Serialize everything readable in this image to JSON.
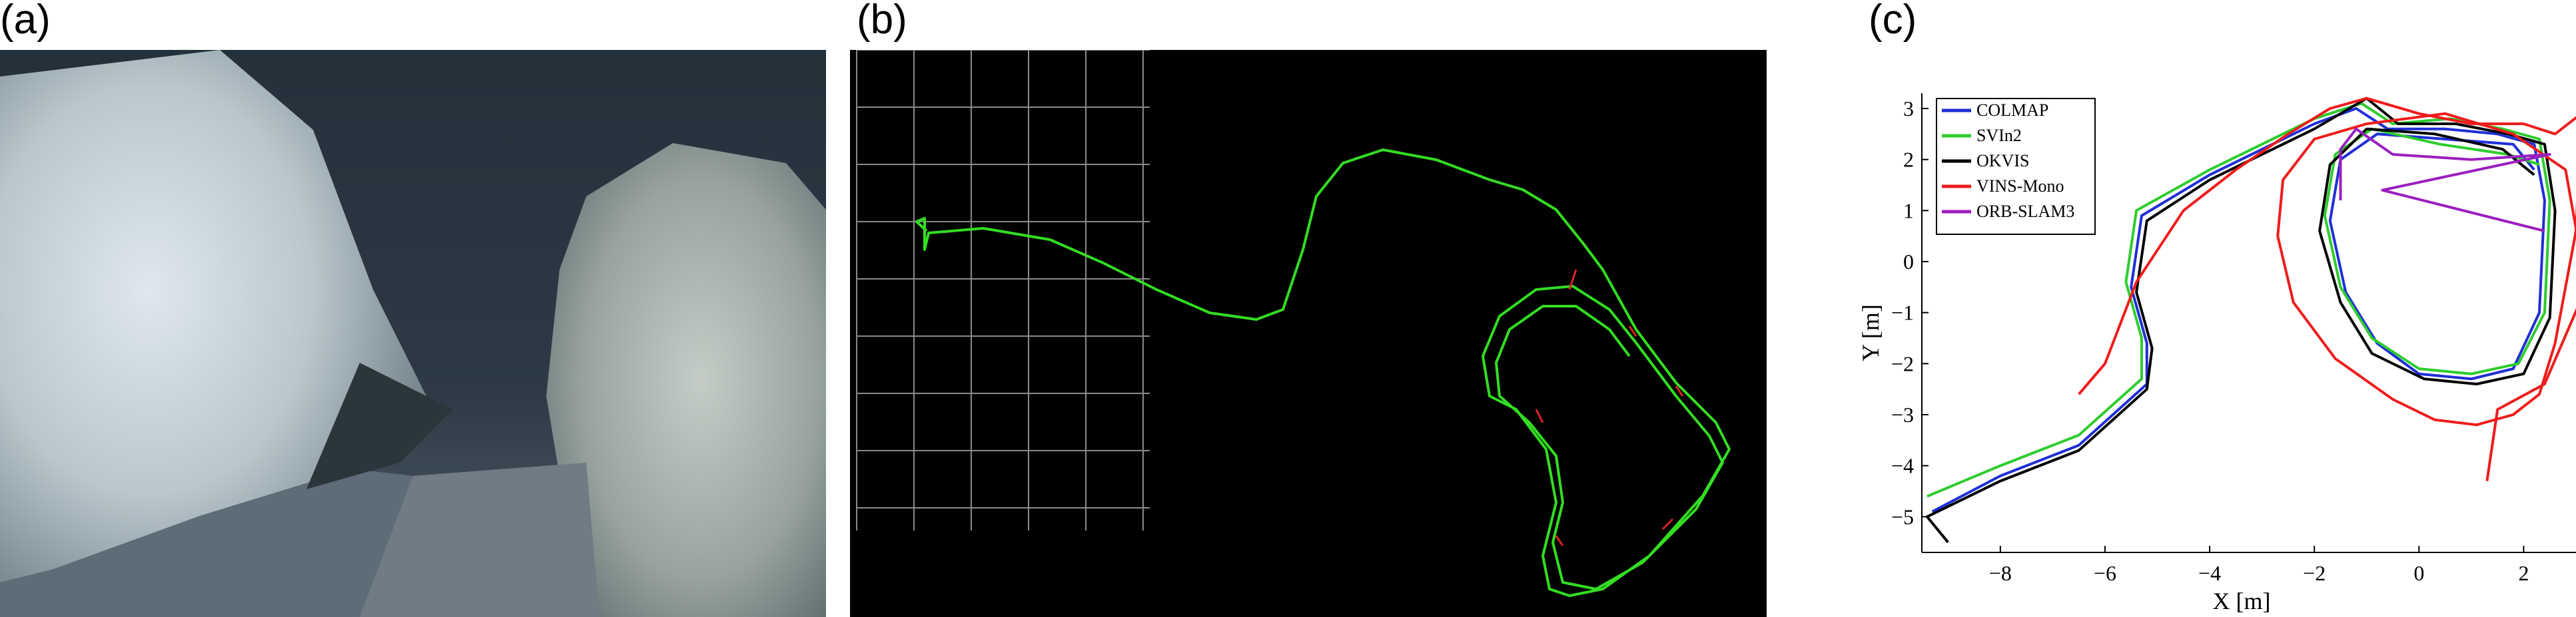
{
  "panels": {
    "a": {
      "label": "(a)"
    },
    "b": {
      "label": "(b)"
    },
    "c": {
      "label": "(c)"
    }
  },
  "colors": {
    "COLMAP": "#1f2fd6",
    "SVIn2": "#2ecc2e",
    "OKVIS": "#000000",
    "VINS-Mono": "#ee1c1c",
    "ORB-SLAM3": "#9b1fbf",
    "grid_b": "#8a8a8a",
    "traj_b": "#33dd22"
  },
  "chart_data": {
    "type": "line",
    "xlabel": "X [m]",
    "ylabel": "Y [m]",
    "xlim": [
      -9.5,
      3
    ],
    "ylim": [
      -5.7,
      3.3
    ],
    "xticks": [
      -8,
      -6,
      -4,
      -2,
      0,
      2
    ],
    "yticks": [
      -5,
      -4,
      -3,
      -2,
      -1,
      0,
      1,
      2,
      3
    ],
    "grid": false,
    "legend_position": "top-left",
    "series": [
      {
        "name": "COLMAP",
        "x": [
          -9.3,
          -8.0,
          -6.5,
          -5.2,
          -5.2,
          -5.5,
          -5.3,
          -4.0,
          -3.0,
          -2.0,
          -1.2,
          -0.6,
          0.5,
          1.5,
          2.2,
          2.4,
          2.3,
          1.8,
          1.0,
          0.0,
          -0.8,
          -1.4,
          -1.7,
          -1.5,
          -0.8,
          0.5,
          1.8,
          2.2
        ],
        "y": [
          -4.9,
          -4.2,
          -3.6,
          -2.4,
          -1.6,
          -0.5,
          0.9,
          1.7,
          2.2,
          2.7,
          3.0,
          2.6,
          2.6,
          2.5,
          2.3,
          1.2,
          -1.0,
          -2.1,
          -2.3,
          -2.2,
          -1.6,
          -0.6,
          0.8,
          2.0,
          2.5,
          2.4,
          2.3,
          1.8
        ]
      },
      {
        "name": "SVIn2",
        "x": [
          -9.4,
          -8.0,
          -6.5,
          -5.3,
          -5.3,
          -5.6,
          -5.4,
          -4.0,
          -3.0,
          -2.0,
          -1.1,
          -0.5,
          0.6,
          1.6,
          2.3,
          2.5,
          2.4,
          1.9,
          1.0,
          0.0,
          -0.9,
          -1.5,
          -1.8,
          -1.6,
          -0.9,
          0.4,
          1.7,
          2.3
        ],
        "y": [
          -4.6,
          -4.0,
          -3.4,
          -2.3,
          -1.5,
          -0.4,
          1.0,
          1.8,
          2.3,
          2.8,
          3.1,
          2.7,
          2.8,
          2.6,
          2.4,
          1.2,
          -1.0,
          -2.0,
          -2.2,
          -2.1,
          -1.5,
          -0.5,
          0.9,
          2.1,
          2.6,
          2.3,
          2.1,
          1.9
        ]
      },
      {
        "name": "OKVIS",
        "x": [
          -9.0,
          -9.4,
          -8.0,
          -6.5,
          -5.2,
          -5.1,
          -5.4,
          -5.2,
          -4.0,
          -3.0,
          -2.0,
          -1.0,
          -0.4,
          0.7,
          1.7,
          2.4,
          2.6,
          2.5,
          2.0,
          1.1,
          0.1,
          -0.9,
          -1.5,
          -1.9,
          -1.7,
          -1.0,
          0.3,
          1.6,
          2.2
        ],
        "y": [
          -5.5,
          -5.0,
          -4.3,
          -3.7,
          -2.5,
          -1.7,
          -0.6,
          0.8,
          1.6,
          2.1,
          2.6,
          3.2,
          2.7,
          2.7,
          2.5,
          2.3,
          1.0,
          -1.1,
          -2.2,
          -2.4,
          -2.3,
          -1.8,
          -0.8,
          0.6,
          1.9,
          2.6,
          2.5,
          2.2,
          1.7
        ]
      },
      {
        "name": "VINS-Mono",
        "x": [
          -6.5,
          -6.0,
          -5.4,
          -4.5,
          -3.5,
          -2.5,
          -1.7,
          -1.0,
          0.0,
          1.0,
          2.0,
          2.6,
          3.1,
          3.0,
          2.6,
          2.3,
          1.8,
          1.1,
          0.3,
          -0.5,
          -1.6,
          -2.4,
          -2.7,
          -2.6,
          -2.0,
          -1.0,
          0.5,
          1.8,
          2.8,
          3.2,
          2.4,
          1.5,
          1.3
        ],
        "y": [
          -2.6,
          -2.0,
          -0.4,
          1.0,
          1.8,
          2.5,
          3.0,
          3.2,
          2.9,
          2.7,
          2.7,
          2.5,
          2.9,
          0.6,
          -1.6,
          -2.6,
          -3.0,
          -3.2,
          -3.1,
          -2.7,
          -1.9,
          -0.8,
          0.5,
          1.6,
          2.4,
          2.7,
          2.9,
          2.5,
          1.8,
          -0.5,
          -2.4,
          -2.9,
          -4.3
        ]
      },
      {
        "name": "ORB-SLAM3",
        "x": [
          -1.5,
          -1.5,
          -1.2,
          -0.5,
          1.0,
          2.5,
          -0.7,
          2.4
        ],
        "y": [
          1.2,
          2.2,
          2.6,
          2.1,
          2.0,
          2.1,
          1.4,
          0.6
        ]
      }
    ]
  }
}
